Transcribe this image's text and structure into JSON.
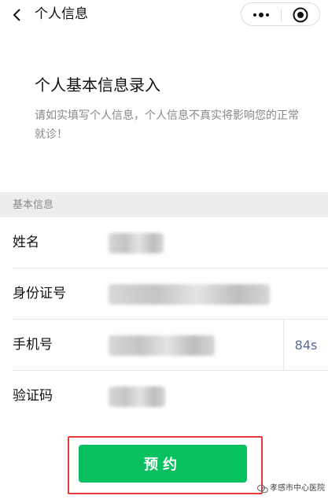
{
  "nav": {
    "title": "个人信息",
    "back_icon": "chevron-left-icon",
    "more_icon": "more-dots-icon",
    "close_icon": "target-close-icon"
  },
  "intro": {
    "heading": "个人基本信息录入",
    "description": "请如实填写个人信息，个人信息不真实将影响您的正常就诊！"
  },
  "section": {
    "label": "基本信息"
  },
  "form": {
    "name_label": "姓名",
    "id_label": "身份证号",
    "phone_label": "手机号",
    "code_label": "验证码",
    "countdown": "84s"
  },
  "submit": {
    "label": "预约"
  },
  "watermark": {
    "text": "孝感市中心医院"
  },
  "colors": {
    "primary_green": "#07c160",
    "link_blue": "#576b95",
    "highlight_red": "#e23b3b"
  }
}
